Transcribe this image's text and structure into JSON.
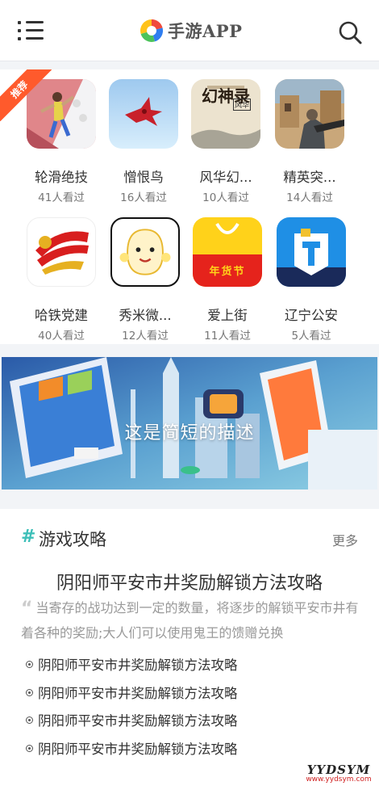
{
  "header": {
    "menu_icon": "menu-icon",
    "logo_text": "手游APP",
    "search_icon": "search-icon"
  },
  "badge": {
    "label": "推荐",
    "color": "#ff5a2c"
  },
  "apps": [
    {
      "name": "轮滑绝技",
      "views": "41人看过"
    },
    {
      "name": "憎恨鸟",
      "views": "16人看过"
    },
    {
      "name": "风华幻...",
      "views": "10人看过"
    },
    {
      "name": "精英突...",
      "views": "14人看过"
    },
    {
      "name": "哈铁党建",
      "views": "40人看过"
    },
    {
      "name": "秀米微...",
      "views": "12人看过"
    },
    {
      "name": "爱上街",
      "views": "11人看过"
    },
    {
      "name": "辽宁公安",
      "views": "5人看过"
    }
  ],
  "icon_art": {
    "app3_title": "幻神录",
    "app3_seal": "风华",
    "app7_banner": "年货节"
  },
  "banner": {
    "caption": "这是简短的描述"
  },
  "guide": {
    "hash": "#",
    "title": "游戏攻略",
    "more": "更多",
    "feature_title": "阴阳师平安市井奖励解锁方法攻略",
    "feature_desc": "当寄存的战功达到一定的数量，将逐步的解锁平安市井有着各种的奖励;大人们可以使用鬼王的馈赠兑换",
    "items": [
      "阴阳师平安市井奖励解锁方法攻略",
      "阴阳师平安市井奖励解锁方法攻略",
      "阴阳师平安市井奖励解锁方法攻略",
      "阴阳师平安市井奖励解锁方法攻略"
    ]
  },
  "watermark": {
    "main": "YYDSYM",
    "sub": "www.yydsym.com"
  },
  "colors": {
    "accent": "#3dbfb8",
    "badge": "#ff5a2c",
    "text": "#333333",
    "muted": "#999999"
  }
}
